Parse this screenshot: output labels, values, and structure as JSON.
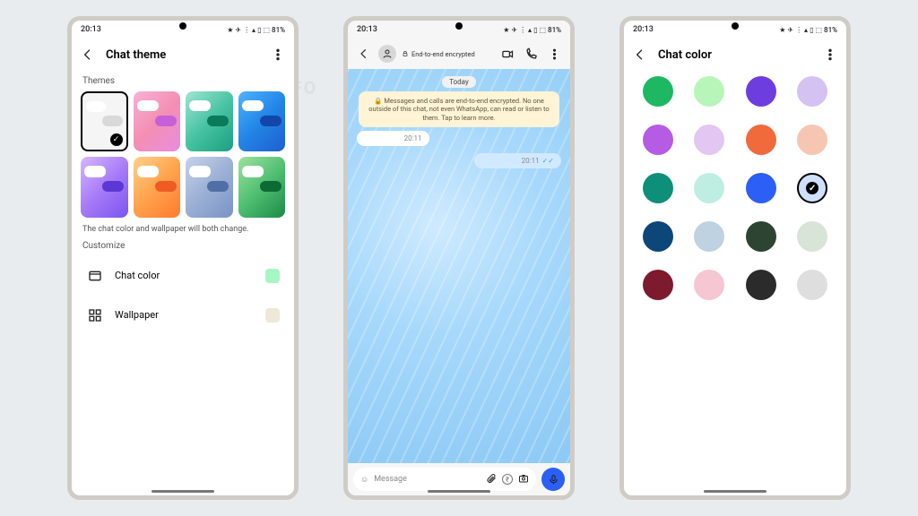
{
  "watermark": "@WABETAINFO",
  "status": {
    "time": "20:13",
    "battery_pct": "81%",
    "icons_text": "★ ✈ ⋮ ▴ ▯ ⬚"
  },
  "screen1": {
    "title": "Chat theme",
    "section_themes": "Themes",
    "themes": [
      {
        "bg": "#ffffff",
        "bubble": "#d0d0d0",
        "selected": true
      },
      {
        "bg": "linear-gradient(135deg,#f8b1da,#f48fb1,#e98ce0)",
        "bubble": "#c65fd9"
      },
      {
        "bg": "linear-gradient(135deg,#9fe5d2,#47c3a3,#1aa07f)",
        "bubble": "#0b7a58"
      },
      {
        "bg": "linear-gradient(135deg,#4fb3ff,#2385e6,#1e5ecf)",
        "bubble": "#1246a8"
      },
      {
        "bg": "linear-gradient(135deg,#d5b8ff,#a77af7,#7b55f0)",
        "bubble": "#5b38d6"
      },
      {
        "bg": "linear-gradient(135deg,#ffd18a,#ffa24c,#ff7a2d)",
        "bubble": "#f05a23"
      },
      {
        "bg": "linear-gradient(135deg,#c7d2ea,#9bb0d6,#7a93c5)",
        "bubble": "#4f6fa6"
      },
      {
        "bg": "linear-gradient(135deg,#9ee29e,#4fbf72,#1c8a47)",
        "bubble": "#0d6a32"
      }
    ],
    "hint": "The chat color and wallpaper will both change.",
    "section_customize": "Customize",
    "chat_color_label": "Chat color",
    "chat_color_swatch": "#a7f7c5",
    "wallpaper_label": "Wallpaper",
    "wallpaper_swatch": "#efe8d8"
  },
  "screen2": {
    "enc_label": "End-to-end encrypted",
    "date": "Today",
    "enc_banner": "🔒 Messages and calls are end-to-end encrypted. No one outside of this chat, not even WhatsApp, can read or listen to them. Tap to learn more.",
    "msg_in_time": "20:11",
    "msg_out_time": "20:11",
    "composer_placeholder": "Message"
  },
  "screen3": {
    "title": "Chat color",
    "colors": [
      "#1eb863",
      "#b8f5b8",
      "#6d3de0",
      "#d3c2f2",
      "#b55be4",
      "#e3c6f2",
      "#f06a3c",
      "#f7c6b3",
      "#0e8f7a",
      "#beeee1",
      "#2b5ff5",
      "#cfe0ff",
      "#0d4678",
      "#bfd2e2",
      "#2e4433",
      "#d7e4d7",
      "#7e1a2d",
      "#f6c6d2",
      "#2b2b2b",
      "#dedede"
    ],
    "selected_index": 11
  }
}
